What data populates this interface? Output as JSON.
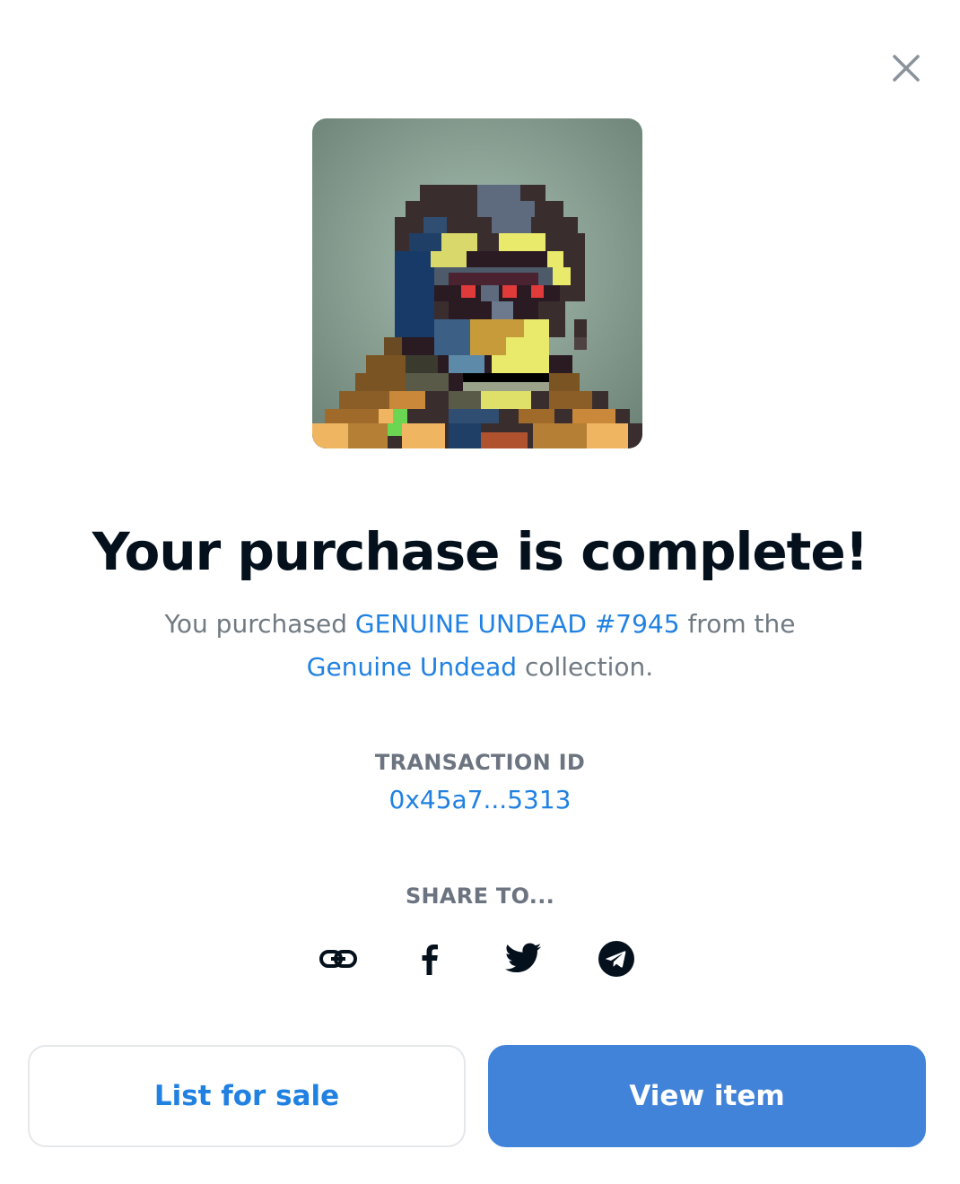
{
  "modal": {
    "title": "Your purchase is complete!",
    "description": {
      "prefix": "You purchased ",
      "item_name": "GENUINE UNDEAD #7945",
      "middle": " from the ",
      "collection_name": "Genuine Undead",
      "suffix": " collection."
    },
    "transaction": {
      "label": "TRANSACTION ID",
      "value": "0x45a7...5313"
    },
    "share": {
      "label": "SHARE TO...",
      "targets": [
        "link-icon",
        "facebook-icon",
        "twitter-icon",
        "telegram-icon"
      ]
    },
    "buttons": {
      "list_for_sale": "List for sale",
      "view_item": "View item"
    },
    "close_icon": "close-icon",
    "colors": {
      "accent": "#2081e2",
      "primary_button": "#4183d9",
      "heading": "#04111d",
      "muted_text": "#707a83"
    }
  }
}
